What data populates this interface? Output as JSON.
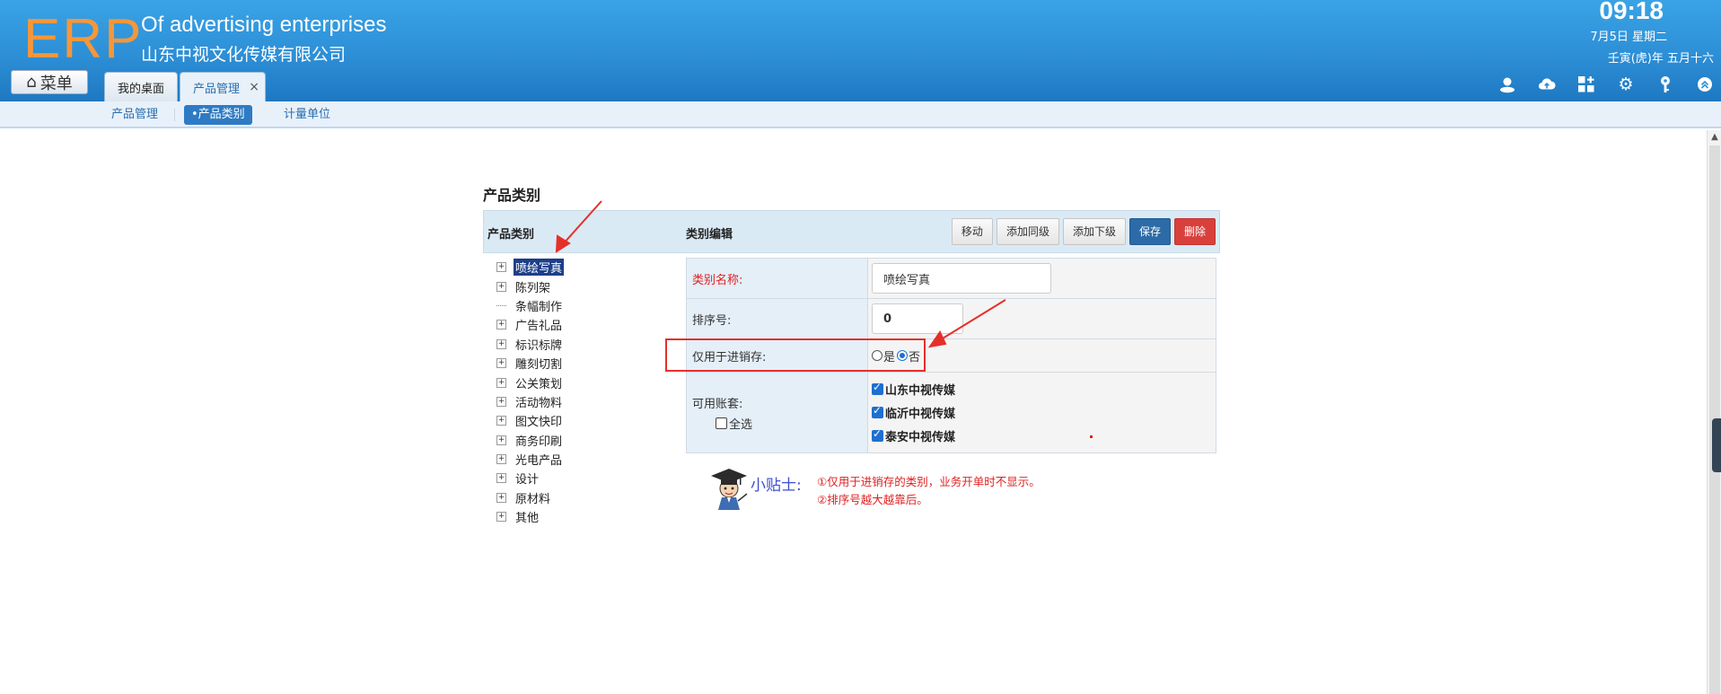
{
  "header": {
    "logo": "ERP",
    "company_en": "Of advertising enterprises",
    "company_cn": "山东中视文化传媒有限公司",
    "time": "09:18",
    "date_line1": "7月5日 星期二",
    "date_line2": "壬寅(虎)年 五月十六"
  },
  "menu_button": {
    "label": "菜单"
  },
  "tabs": [
    {
      "label": "我的桌面"
    },
    {
      "label": "产品管理",
      "close": "×"
    }
  ],
  "header_icons": [
    "user-icon",
    "cloud-upload-icon",
    "apps-icon",
    "settings-icon",
    "key-icon",
    "collapse-icon"
  ],
  "subnav": {
    "items": [
      {
        "label": "产品管理"
      },
      {
        "label": "•产品类别"
      },
      {
        "label": "计量单位"
      }
    ]
  },
  "page": {
    "title": "产品类别",
    "tree_header": "产品类别",
    "edit_header": "类别编辑",
    "buttons": {
      "move": "移动",
      "add_same": "添加同级",
      "add_child": "添加下级",
      "save": "保存",
      "delete": "删除"
    }
  },
  "tree": [
    {
      "label": "喷绘写真",
      "expand": "+",
      "selected": true
    },
    {
      "label": "陈列架",
      "expand": "+"
    },
    {
      "label": "条幅制作",
      "expand": ""
    },
    {
      "label": "广告礼品",
      "expand": "+"
    },
    {
      "label": "标识标牌",
      "expand": "+"
    },
    {
      "label": "雕刻切割",
      "expand": "+"
    },
    {
      "label": "公关策划",
      "expand": "+"
    },
    {
      "label": "活动物料",
      "expand": "+"
    },
    {
      "label": "图文快印",
      "expand": "+"
    },
    {
      "label": "商务印刷",
      "expand": "+"
    },
    {
      "label": "光电产品",
      "expand": "+"
    },
    {
      "label": "设计",
      "expand": "+"
    },
    {
      "label": "原材料",
      "expand": "+"
    },
    {
      "label": "其他",
      "expand": "+"
    }
  ],
  "form": {
    "name_label": "类别名称:",
    "name_value": "喷绘写真",
    "sort_label": "排序号:",
    "sort_value": "0",
    "inventory_label": "仅用于进销存:",
    "inventory_yes": "是",
    "inventory_no": "否",
    "inventory_selected": "否",
    "accounts_label": "可用账套:",
    "select_all": "全选",
    "accounts": [
      {
        "label": "山东中视传媒",
        "checked": true
      },
      {
        "label": "临沂中视传媒",
        "checked": true
      },
      {
        "label": "泰安中视传媒",
        "checked": true
      }
    ]
  },
  "tips": {
    "title": "小贴士:",
    "line1": "①仅用于进销存的类别，业务开单时不显示。",
    "line2": "②排序号越大越靠后。"
  },
  "colors": {
    "header": "#2d8fd6",
    "logo": "#f5973a",
    "save": "#2c6ba8",
    "delete": "#d9403c",
    "annotation": "#e5302a"
  }
}
